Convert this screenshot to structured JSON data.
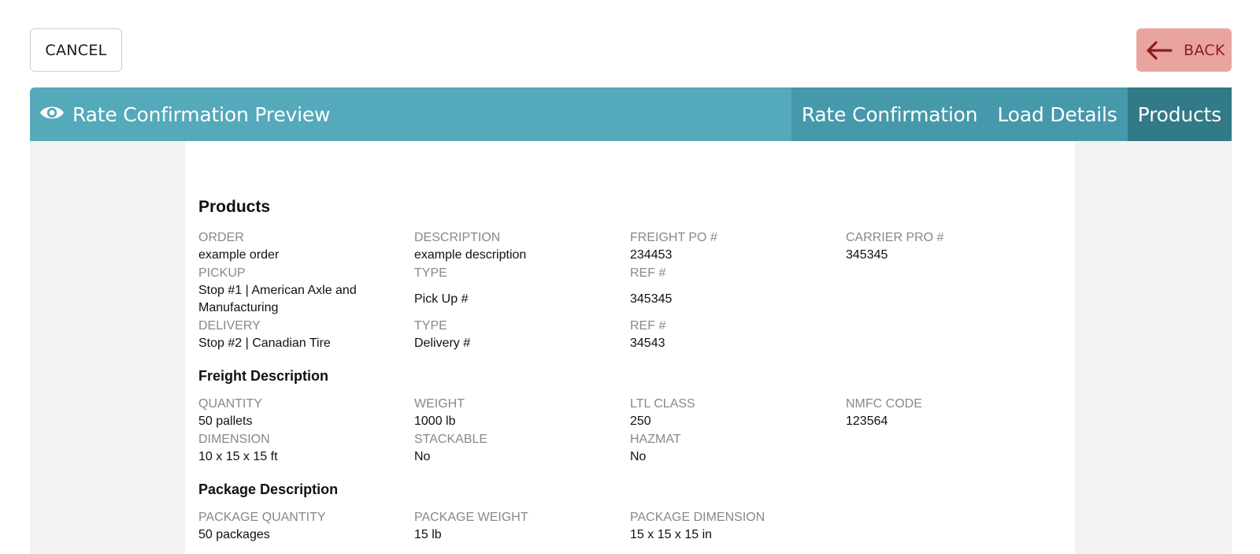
{
  "toolbar": {
    "cancel_label": "CANCEL",
    "back_label": "BACK",
    "back_icon": "arrow-left-icon"
  },
  "header": {
    "icon": "eye-icon",
    "title": "Rate Confirmation Preview",
    "tabs": [
      {
        "label": "Rate Confirmation",
        "active": false
      },
      {
        "label": "Load Details",
        "active": false
      },
      {
        "label": "Products",
        "active": true
      }
    ]
  },
  "colors": {
    "header_bg": "#54a9ba",
    "tab_bg": "#4599aa",
    "tab_active_bg": "#327a88",
    "back_bg": "#eaa49f",
    "back_text": "#8a1d1d"
  },
  "products": {
    "title": "Products",
    "order": {
      "label": "ORDER",
      "value": "example order"
    },
    "description": {
      "label": "DESCRIPTION",
      "value": "example description"
    },
    "freight_po": {
      "label": "FREIGHT PO #",
      "value": "234453"
    },
    "carrier_pro": {
      "label": "CARRIER PRO #",
      "value": "345345"
    },
    "pickup": {
      "label": "PICKUP",
      "value": "Stop #1 | American Axle and Manufacturing"
    },
    "pickup_type": {
      "label": "TYPE",
      "value": "Pick Up #"
    },
    "pickup_ref": {
      "label": "REF #",
      "value": "345345"
    },
    "delivery": {
      "label": "DELIVERY",
      "value": "Stop #2 | Canadian Tire"
    },
    "delivery_type": {
      "label": "TYPE",
      "value": "Delivery #"
    },
    "delivery_ref": {
      "label": "REF #",
      "value": "34543"
    }
  },
  "freight": {
    "title": "Freight Description",
    "quantity": {
      "label": "QUANTITY",
      "value": "50 pallets"
    },
    "weight": {
      "label": "WEIGHT",
      "value": "1000 lb"
    },
    "ltl_class": {
      "label": "LTL CLASS",
      "value": "250"
    },
    "nmfc_code": {
      "label": "NMFC CODE",
      "value": "123564"
    },
    "dimension": {
      "label": "DIMENSION",
      "value": "10 x 15 x 15 ft"
    },
    "stackable": {
      "label": "STACKABLE",
      "value": "No"
    },
    "hazmat": {
      "label": "HAZMAT",
      "value": "No"
    }
  },
  "package": {
    "title": "Package Description",
    "quantity": {
      "label": "PACKAGE QUANTITY",
      "value": "50 packages"
    },
    "weight": {
      "label": "PACKAGE WEIGHT",
      "value": "15 lb"
    },
    "dimension": {
      "label": "PACKAGE DIMENSION",
      "value": "15 x 15 x 15 in"
    }
  }
}
